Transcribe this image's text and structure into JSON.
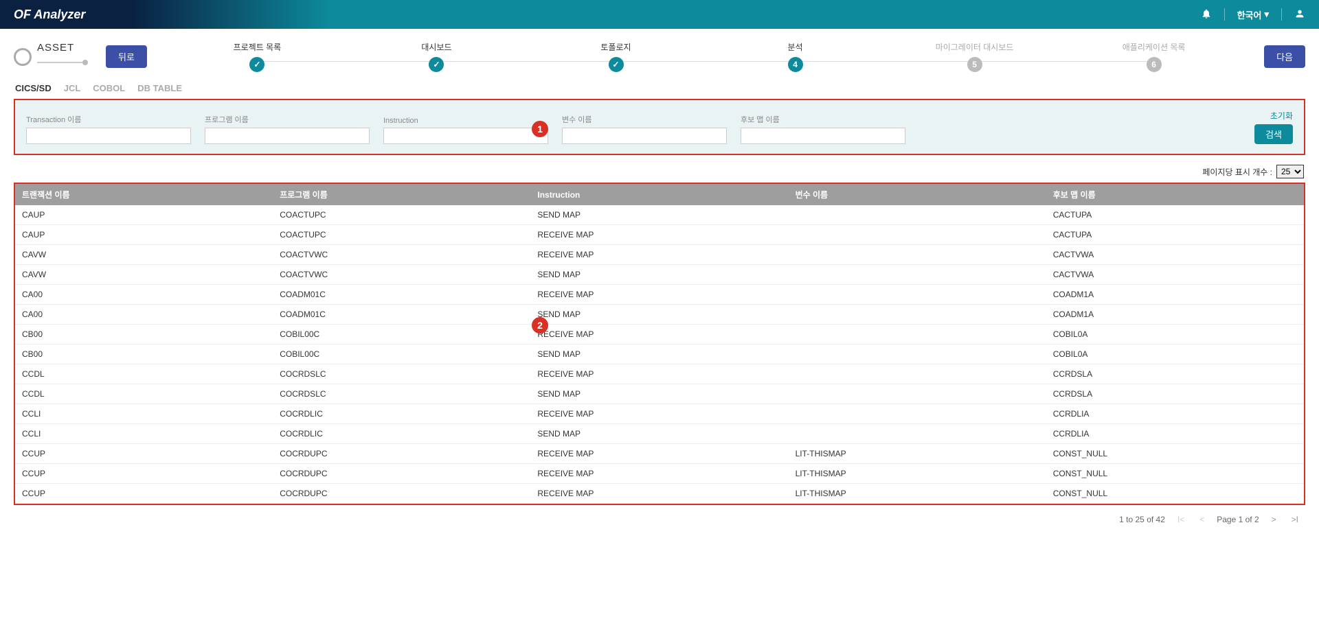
{
  "header": {
    "logo": "OF Analyzer",
    "language": "한국어"
  },
  "stepper": {
    "asset_label": "ASSET",
    "back_label": "뒤로",
    "next_label": "다음",
    "steps": [
      {
        "label": "프로젝트 목록",
        "state": "done",
        "mark": "✓"
      },
      {
        "label": "대시보드",
        "state": "done",
        "mark": "✓"
      },
      {
        "label": "토폴로지",
        "state": "done",
        "mark": "✓"
      },
      {
        "label": "분석",
        "state": "active",
        "mark": "4"
      },
      {
        "label": "마이그레이터 대시보드",
        "state": "pending",
        "mark": "5"
      },
      {
        "label": "애플리케이션 목록",
        "state": "pending",
        "mark": "6"
      }
    ]
  },
  "tabs": [
    {
      "label": "CICS/SD",
      "active": true
    },
    {
      "label": "JCL",
      "active": false
    },
    {
      "label": "COBOL",
      "active": false
    },
    {
      "label": "DB TABLE",
      "active": false
    }
  ],
  "filters": {
    "transaction_label": "Transaction 이름",
    "program_label": "프로그램 이름",
    "instruction_label": "Instruction",
    "variable_label": "변수 이름",
    "candidate_label": "후보 맵 이름",
    "reset_label": "초기화",
    "search_label": "검색"
  },
  "pagesize": {
    "label": "페이지당 표시 개수 :",
    "value": "25"
  },
  "table": {
    "headers": {
      "transaction": "트랜잭션 이름",
      "program": "프로그램 이름",
      "instruction": "Instruction",
      "variable": "변수 이름",
      "candidate": "후보 맵 이름"
    },
    "rows": [
      {
        "t": "CAUP",
        "p": "COACTUPC",
        "i": "SEND MAP",
        "v": "",
        "c": "CACTUPA"
      },
      {
        "t": "CAUP",
        "p": "COACTUPC",
        "i": "RECEIVE MAP",
        "v": "",
        "c": "CACTUPA"
      },
      {
        "t": "CAVW",
        "p": "COACTVWC",
        "i": "RECEIVE MAP",
        "v": "",
        "c": "CACTVWA"
      },
      {
        "t": "CAVW",
        "p": "COACTVWC",
        "i": "SEND MAP",
        "v": "",
        "c": "CACTVWA"
      },
      {
        "t": "CA00",
        "p": "COADM01C",
        "i": "RECEIVE MAP",
        "v": "",
        "c": "COADM1A"
      },
      {
        "t": "CA00",
        "p": "COADM01C",
        "i": "SEND MAP",
        "v": "",
        "c": "COADM1A"
      },
      {
        "t": "CB00",
        "p": "COBIL00C",
        "i": "RECEIVE MAP",
        "v": "",
        "c": "COBIL0A"
      },
      {
        "t": "CB00",
        "p": "COBIL00C",
        "i": "SEND MAP",
        "v": "",
        "c": "COBIL0A"
      },
      {
        "t": "CCDL",
        "p": "COCRDSLC",
        "i": "RECEIVE MAP",
        "v": "",
        "c": "CCRDSLA"
      },
      {
        "t": "CCDL",
        "p": "COCRDSLC",
        "i": "SEND MAP",
        "v": "",
        "c": "CCRDSLA"
      },
      {
        "t": "CCLI",
        "p": "COCRDLIC",
        "i": "RECEIVE MAP",
        "v": "",
        "c": "CCRDLIA"
      },
      {
        "t": "CCLI",
        "p": "COCRDLIC",
        "i": "SEND MAP",
        "v": "",
        "c": "CCRDLIA"
      },
      {
        "t": "CCUP",
        "p": "COCRDUPC",
        "i": "RECEIVE MAP",
        "v": "LIT-THISMAP",
        "c": "CONST_NULL"
      },
      {
        "t": "CCUP",
        "p": "COCRDUPC",
        "i": "RECEIVE MAP",
        "v": "LIT-THISMAP",
        "c": "CONST_NULL"
      },
      {
        "t": "CCUP",
        "p": "COCRDUPC",
        "i": "RECEIVE MAP",
        "v": "LIT-THISMAP",
        "c": "CONST_NULL"
      }
    ]
  },
  "pager": {
    "range": "1 to 25 of 42",
    "page_label": "Page 1 of 2"
  },
  "callouts": {
    "one": "1",
    "two": "2"
  }
}
